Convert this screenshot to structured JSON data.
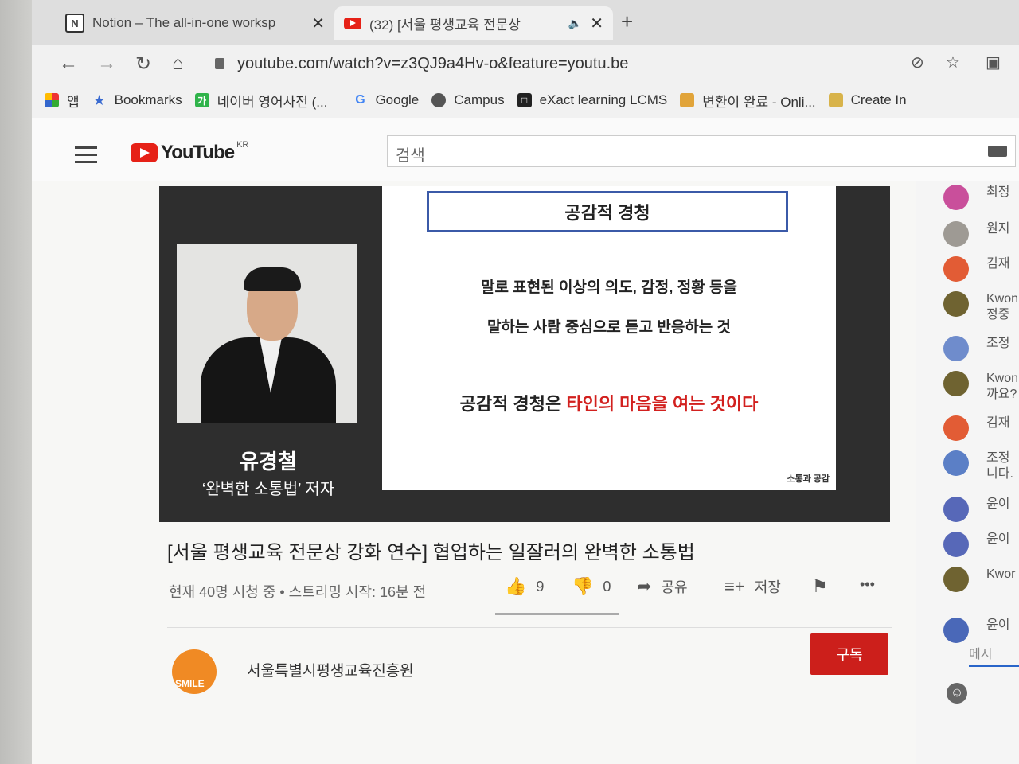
{
  "browser": {
    "tabs": [
      {
        "title": "Notion – The all-in-one worksp",
        "favicon": "notion-icon"
      },
      {
        "title": "(32) [서울 평생교육 전문상",
        "favicon": "youtube-icon"
      }
    ],
    "new_tab": "+",
    "address": "youtube.com/watch?v=z3QJ9a4Hv-o&feature=youtu.be",
    "bookmarks": [
      {
        "label": "앱",
        "icon": "apps-grid-icon"
      },
      {
        "label": "Bookmarks",
        "icon": "star-icon"
      },
      {
        "label": "네이버 영어사전 (...",
        "icon": "naver-dict-icon"
      },
      {
        "label": "Google",
        "icon": "google-icon"
      },
      {
        "label": "Campus",
        "icon": "globe-icon"
      },
      {
        "label": "eXact learning LCMS",
        "icon": "exact-icon"
      },
      {
        "label": "변환이 완료 - Onli...",
        "icon": "camera-icon"
      },
      {
        "label": "Create In",
        "icon": "doc-icon"
      }
    ]
  },
  "youtube": {
    "logo_text": "YouTube",
    "region": "KR",
    "search_placeholder": "검색"
  },
  "video": {
    "speaker_name": "유경철",
    "speaker_subtitle": "‘완벽한 소통법’ 저자",
    "slide_title": "공감적 경청",
    "slide_line1": "말로 표현된 이상의 의도, 감정, 정황 등을",
    "slide_line2": "말하는 사람 중심으로 듣고 반응하는 것",
    "slide_line3_black": "공감적 경청은 ",
    "slide_line3_red": "타인의 마음을 여는 것이다",
    "slide_logo": "소통과 공감"
  },
  "info": {
    "title": "[서울 평생교육 전문상 강화 연수] 협업하는 일잘러의 완벽한 소통법",
    "meta": "현재 40명 시청 중 • 스트리밍 시작: 16분 전",
    "likes": "9",
    "dislikes": "0",
    "share": "공유",
    "save": "저장",
    "more": "•••"
  },
  "channel": {
    "name": "서울특별시평생교육진흥원",
    "avatar_text": "SMILE",
    "subscribe": "구독"
  },
  "chat": {
    "messages": [
      {
        "text": "최정",
        "color": "#c94f9b"
      },
      {
        "text": "원지",
        "color": "#9e9a94"
      },
      {
        "text": "김재",
        "color": "#e25c35"
      },
      {
        "text": "Kwon\n정중",
        "color": "#6f6331"
      },
      {
        "text": "조정",
        "color": "#6f8ccc"
      },
      {
        "text": "Kwon\n까요?",
        "color": "#6f6331"
      },
      {
        "text": "김재",
        "color": "#e25c35"
      },
      {
        "text": "조정\n니다.",
        "color": "#5b7fc6"
      },
      {
        "text": "윤이",
        "color": "#5768b8"
      },
      {
        "text": "윤이",
        "color": "#5768b8"
      },
      {
        "text": "Kwor",
        "color": "#6f6331"
      },
      {
        "text": "윤이",
        "color": "#4a68b8"
      }
    ],
    "input_placeholder": "메시",
    "emoji": "☺"
  }
}
